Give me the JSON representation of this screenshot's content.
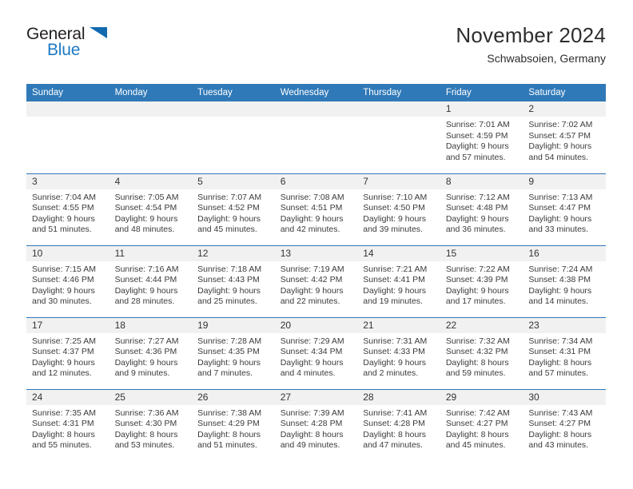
{
  "brand": {
    "name_part1": "General",
    "name_part2": "Blue",
    "triangle_icon": "triangle-icon",
    "accent_color": "#1169b0"
  },
  "header": {
    "title": "November 2024",
    "subtitle": "Schwabsoien, Germany"
  },
  "calendar": {
    "header_bg": "#3079b8",
    "daynum_bg": "#f1f1f1",
    "weekdays": [
      "Sunday",
      "Monday",
      "Tuesday",
      "Wednesday",
      "Thursday",
      "Friday",
      "Saturday"
    ],
    "weeks": [
      [
        {
          "day": "",
          "sunrise": "",
          "sunset": "",
          "daylight1": "",
          "daylight2": ""
        },
        {
          "day": "",
          "sunrise": "",
          "sunset": "",
          "daylight1": "",
          "daylight2": ""
        },
        {
          "day": "",
          "sunrise": "",
          "sunset": "",
          "daylight1": "",
          "daylight2": ""
        },
        {
          "day": "",
          "sunrise": "",
          "sunset": "",
          "daylight1": "",
          "daylight2": ""
        },
        {
          "day": "",
          "sunrise": "",
          "sunset": "",
          "daylight1": "",
          "daylight2": ""
        },
        {
          "day": "1",
          "sunrise": "Sunrise: 7:01 AM",
          "sunset": "Sunset: 4:59 PM",
          "daylight1": "Daylight: 9 hours",
          "daylight2": "and 57 minutes."
        },
        {
          "day": "2",
          "sunrise": "Sunrise: 7:02 AM",
          "sunset": "Sunset: 4:57 PM",
          "daylight1": "Daylight: 9 hours",
          "daylight2": "and 54 minutes."
        }
      ],
      [
        {
          "day": "3",
          "sunrise": "Sunrise: 7:04 AM",
          "sunset": "Sunset: 4:55 PM",
          "daylight1": "Daylight: 9 hours",
          "daylight2": "and 51 minutes."
        },
        {
          "day": "4",
          "sunrise": "Sunrise: 7:05 AM",
          "sunset": "Sunset: 4:54 PM",
          "daylight1": "Daylight: 9 hours",
          "daylight2": "and 48 minutes."
        },
        {
          "day": "5",
          "sunrise": "Sunrise: 7:07 AM",
          "sunset": "Sunset: 4:52 PM",
          "daylight1": "Daylight: 9 hours",
          "daylight2": "and 45 minutes."
        },
        {
          "day": "6",
          "sunrise": "Sunrise: 7:08 AM",
          "sunset": "Sunset: 4:51 PM",
          "daylight1": "Daylight: 9 hours",
          "daylight2": "and 42 minutes."
        },
        {
          "day": "7",
          "sunrise": "Sunrise: 7:10 AM",
          "sunset": "Sunset: 4:50 PM",
          "daylight1": "Daylight: 9 hours",
          "daylight2": "and 39 minutes."
        },
        {
          "day": "8",
          "sunrise": "Sunrise: 7:12 AM",
          "sunset": "Sunset: 4:48 PM",
          "daylight1": "Daylight: 9 hours",
          "daylight2": "and 36 minutes."
        },
        {
          "day": "9",
          "sunrise": "Sunrise: 7:13 AM",
          "sunset": "Sunset: 4:47 PM",
          "daylight1": "Daylight: 9 hours",
          "daylight2": "and 33 minutes."
        }
      ],
      [
        {
          "day": "10",
          "sunrise": "Sunrise: 7:15 AM",
          "sunset": "Sunset: 4:46 PM",
          "daylight1": "Daylight: 9 hours",
          "daylight2": "and 30 minutes."
        },
        {
          "day": "11",
          "sunrise": "Sunrise: 7:16 AM",
          "sunset": "Sunset: 4:44 PM",
          "daylight1": "Daylight: 9 hours",
          "daylight2": "and 28 minutes."
        },
        {
          "day": "12",
          "sunrise": "Sunrise: 7:18 AM",
          "sunset": "Sunset: 4:43 PM",
          "daylight1": "Daylight: 9 hours",
          "daylight2": "and 25 minutes."
        },
        {
          "day": "13",
          "sunrise": "Sunrise: 7:19 AM",
          "sunset": "Sunset: 4:42 PM",
          "daylight1": "Daylight: 9 hours",
          "daylight2": "and 22 minutes."
        },
        {
          "day": "14",
          "sunrise": "Sunrise: 7:21 AM",
          "sunset": "Sunset: 4:41 PM",
          "daylight1": "Daylight: 9 hours",
          "daylight2": "and 19 minutes."
        },
        {
          "day": "15",
          "sunrise": "Sunrise: 7:22 AM",
          "sunset": "Sunset: 4:39 PM",
          "daylight1": "Daylight: 9 hours",
          "daylight2": "and 17 minutes."
        },
        {
          "day": "16",
          "sunrise": "Sunrise: 7:24 AM",
          "sunset": "Sunset: 4:38 PM",
          "daylight1": "Daylight: 9 hours",
          "daylight2": "and 14 minutes."
        }
      ],
      [
        {
          "day": "17",
          "sunrise": "Sunrise: 7:25 AM",
          "sunset": "Sunset: 4:37 PM",
          "daylight1": "Daylight: 9 hours",
          "daylight2": "and 12 minutes."
        },
        {
          "day": "18",
          "sunrise": "Sunrise: 7:27 AM",
          "sunset": "Sunset: 4:36 PM",
          "daylight1": "Daylight: 9 hours",
          "daylight2": "and 9 minutes."
        },
        {
          "day": "19",
          "sunrise": "Sunrise: 7:28 AM",
          "sunset": "Sunset: 4:35 PM",
          "daylight1": "Daylight: 9 hours",
          "daylight2": "and 7 minutes."
        },
        {
          "day": "20",
          "sunrise": "Sunrise: 7:29 AM",
          "sunset": "Sunset: 4:34 PM",
          "daylight1": "Daylight: 9 hours",
          "daylight2": "and 4 minutes."
        },
        {
          "day": "21",
          "sunrise": "Sunrise: 7:31 AM",
          "sunset": "Sunset: 4:33 PM",
          "daylight1": "Daylight: 9 hours",
          "daylight2": "and 2 minutes."
        },
        {
          "day": "22",
          "sunrise": "Sunrise: 7:32 AM",
          "sunset": "Sunset: 4:32 PM",
          "daylight1": "Daylight: 8 hours",
          "daylight2": "and 59 minutes."
        },
        {
          "day": "23",
          "sunrise": "Sunrise: 7:34 AM",
          "sunset": "Sunset: 4:31 PM",
          "daylight1": "Daylight: 8 hours",
          "daylight2": "and 57 minutes."
        }
      ],
      [
        {
          "day": "24",
          "sunrise": "Sunrise: 7:35 AM",
          "sunset": "Sunset: 4:31 PM",
          "daylight1": "Daylight: 8 hours",
          "daylight2": "and 55 minutes."
        },
        {
          "day": "25",
          "sunrise": "Sunrise: 7:36 AM",
          "sunset": "Sunset: 4:30 PM",
          "daylight1": "Daylight: 8 hours",
          "daylight2": "and 53 minutes."
        },
        {
          "day": "26",
          "sunrise": "Sunrise: 7:38 AM",
          "sunset": "Sunset: 4:29 PM",
          "daylight1": "Daylight: 8 hours",
          "daylight2": "and 51 minutes."
        },
        {
          "day": "27",
          "sunrise": "Sunrise: 7:39 AM",
          "sunset": "Sunset: 4:28 PM",
          "daylight1": "Daylight: 8 hours",
          "daylight2": "and 49 minutes."
        },
        {
          "day": "28",
          "sunrise": "Sunrise: 7:41 AM",
          "sunset": "Sunset: 4:28 PM",
          "daylight1": "Daylight: 8 hours",
          "daylight2": "and 47 minutes."
        },
        {
          "day": "29",
          "sunrise": "Sunrise: 7:42 AM",
          "sunset": "Sunset: 4:27 PM",
          "daylight1": "Daylight: 8 hours",
          "daylight2": "and 45 minutes."
        },
        {
          "day": "30",
          "sunrise": "Sunrise: 7:43 AM",
          "sunset": "Sunset: 4:27 PM",
          "daylight1": "Daylight: 8 hours",
          "daylight2": "and 43 minutes."
        }
      ]
    ]
  }
}
